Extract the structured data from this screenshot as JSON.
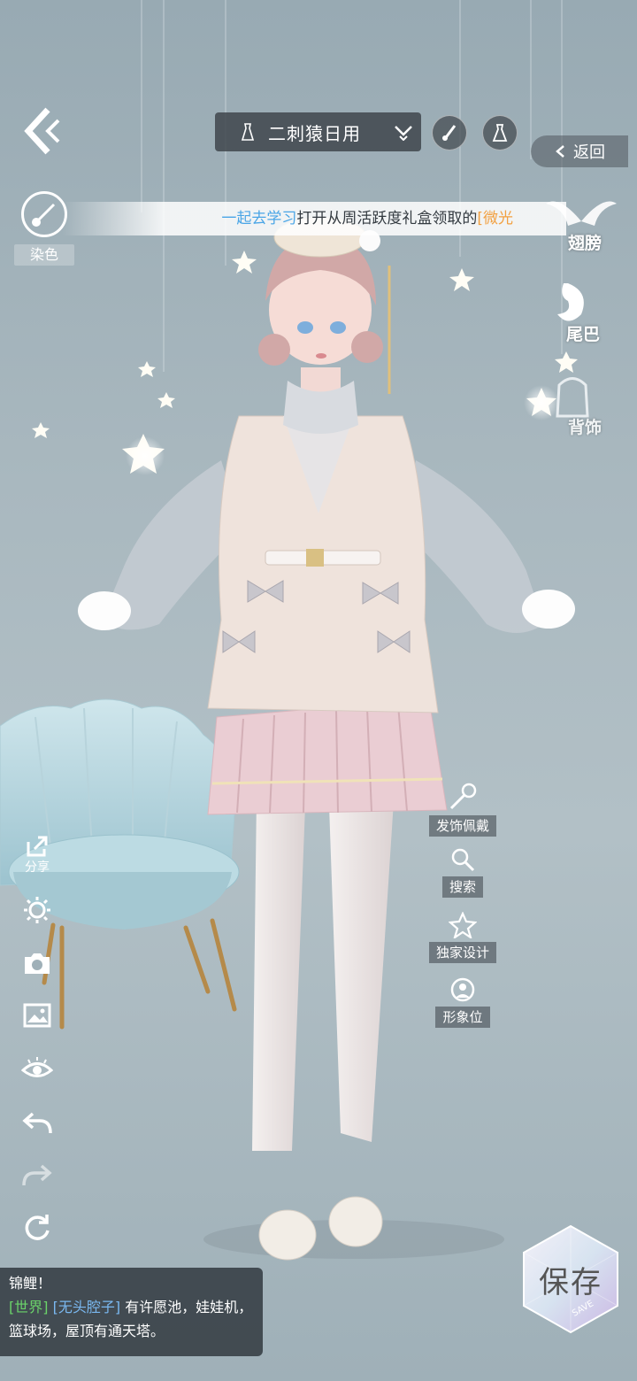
{
  "top_bar": {
    "outfit_name": "二刺猿日用",
    "back_label": "返回",
    "icons": [
      "back-arrow-icon",
      "dress-icon",
      "chevron-down-icon",
      "brush-icon",
      "dress-outline-icon"
    ]
  },
  "dye": {
    "label": "染色"
  },
  "announcement": {
    "highlight": "一起去学习",
    "text": "打开从周活跃度礼盒领取的",
    "emphasis": "[微光"
  },
  "right_slots": [
    {
      "label": "翅膀",
      "icon": "wings-icon"
    },
    {
      "label": "尾巴",
      "icon": "tail-icon"
    },
    {
      "label": "背饰",
      "icon": "backpack-icon"
    }
  ],
  "left_tools": [
    {
      "label": "分享",
      "icon": "share-icon"
    },
    {
      "label": "",
      "icon": "sun-icon"
    },
    {
      "label": "",
      "icon": "camera-icon"
    },
    {
      "label": "",
      "icon": "image-icon"
    },
    {
      "label": "",
      "icon": "eye-icon"
    },
    {
      "label": "",
      "icon": "undo-icon"
    },
    {
      "label": "",
      "icon": "redo-icon"
    },
    {
      "label": "",
      "icon": "reset-icon"
    }
  ],
  "actions": [
    {
      "label": "发饰佩戴",
      "icon": "hairpin-icon"
    },
    {
      "label": "搜索",
      "icon": "search-icon"
    },
    {
      "label": "独家设计",
      "icon": "star-icon"
    },
    {
      "label": "形象位",
      "icon": "portrait-icon"
    }
  ],
  "chat": {
    "line1": "锦鲤！",
    "channel": "[世界]",
    "user": "[无头腔子]",
    "message": "有许愿池，娃娃机，篮球场，屋顶有通天塔。"
  },
  "save": {
    "label": "保存",
    "sub": "SAVE"
  },
  "colors": {
    "accent_blue": "#4aa5e6",
    "accent_orange": "#f2a040",
    "chat_green": "#6bd36a",
    "chat_user": "#7ab8f0"
  }
}
